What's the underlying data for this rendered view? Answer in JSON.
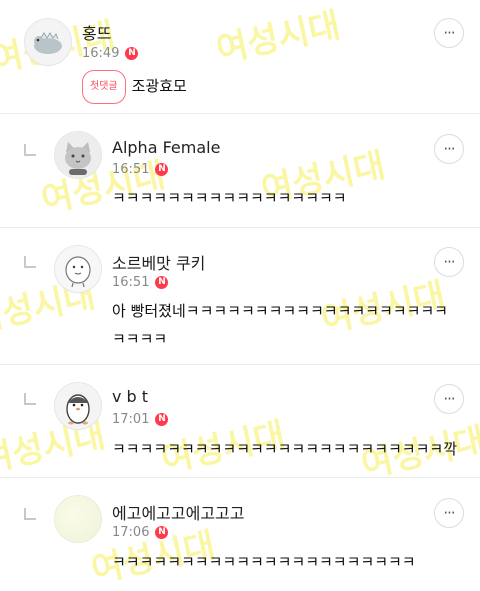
{
  "ui": {
    "more_label": "···",
    "new_badge": "N",
    "first_comment_tag": "첫댓글"
  },
  "watermark_text": "여성시대",
  "comments": [
    {
      "nickname": "홍뜨",
      "time": "16:49",
      "text": "조광효모",
      "is_first": true,
      "avatar_icon": "dinosaur-icon"
    },
    {
      "nickname": "Alpha Female",
      "time": "16:51",
      "text": "ㅋㅋㅋㅋㅋㅋㅋㅋㅋㅋㅋㅋㅋㅋㅋㅋㅋ",
      "avatar_icon": "cat-icon"
    },
    {
      "nickname": "소르베맛 쿠키",
      "time": "16:51",
      "text": "아 빵터졌네ㅋㅋㅋㅋㅋㅋㅋㅋㅋㅋㅋㅋㅋㅋㅋㅋㅋㅋㅋㅋㅋㅋㅋ",
      "avatar_icon": "bean-character-icon"
    },
    {
      "nickname": "v b t",
      "time": "17:01",
      "text": "ㅋㅋㅋㅋㅋㅋㅋㅋㅋㅋㅋㅋㅋㅋㅋㅋㅋㅋㅋㅋㅋㅋㅋㅋ깍",
      "avatar_icon": "penguin-icon"
    },
    {
      "nickname": "에고에고고에고고고",
      "time": "17:06",
      "text": "ㅋㅋㅋㅋㅋㅋㅋㅋㅋㅋㅋㅋㅋㅋㅋㅋㅋㅋㅋㅋㅋㅋ",
      "avatar_icon": "blank-avatar-icon"
    }
  ]
}
